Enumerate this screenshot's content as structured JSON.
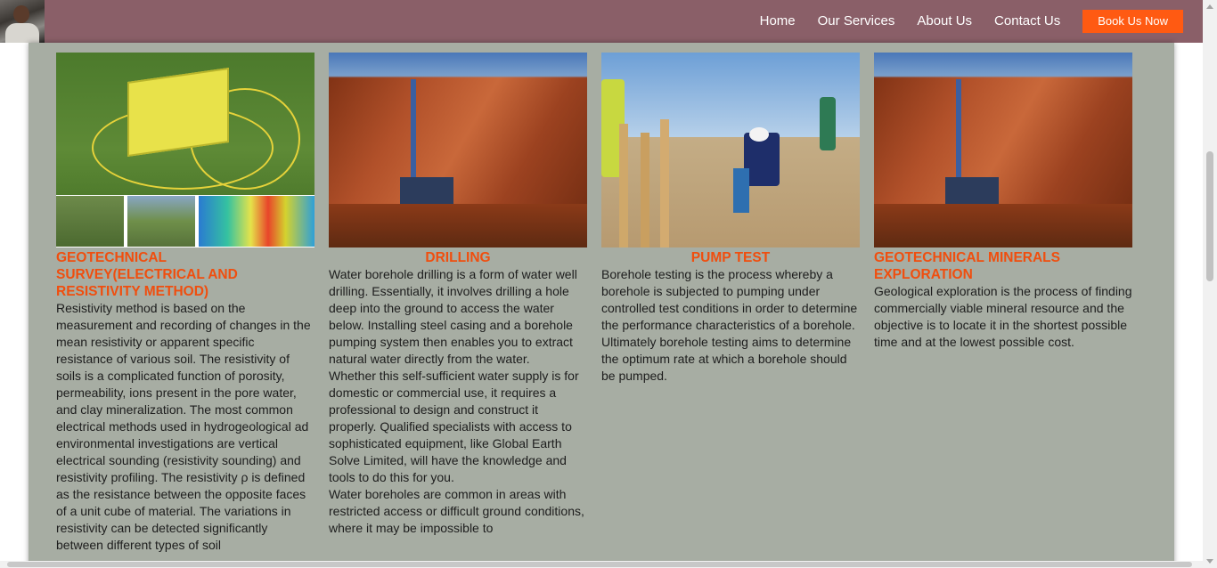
{
  "nav": {
    "items": [
      "Home",
      "Our Services",
      "About Us",
      "Contact Us"
    ],
    "cta": "Book Us Now"
  },
  "colors": {
    "header": "#8a5f68",
    "panel": "#a7ada3",
    "accent": "#f04e0e",
    "cta": "#ff5a12"
  },
  "services": [
    {
      "title": "GEOTECHNICAL SURVEY(ELECTRICAL AND RESISTIVITY METHOD)",
      "body": "Resistivity method is based on the measurement and recording of changes in the mean resistivity or apparent specific resistance of various soil. The resistivity of soils is a complicated function of porosity, permeability, ions present in the pore water, and clay mineralization. The most common electrical methods used in hydrogeological ad environmental investigations are vertical electrical sounding (resistivity sounding) and resistivity profiling. The resistivity ρ is defined as the resistance between the opposite faces of a unit cube of material. The variations in resistivity can be detected significantly between different types of soil"
    },
    {
      "title": "DRILLING",
      "body": "Water borehole drilling is a form of water well drilling. Essentially, it involves drilling a hole deep into the ground to access the water below. Installing steel casing and a borehole pumping system then enables you to extract natural water directly from the water.",
      "body2": "Whether this self-sufficient water supply is for domestic or commercial use, it requires a professional to design and construct it properly. Qualified specialists with access to sophisticated equipment, like Global Earth Solve Limited, will have the knowledge and tools to do this for you.",
      "body3": "Water boreholes are common in areas with restricted access or difficult ground conditions, where it may be impossible to"
    },
    {
      "title": "PUMP TEST",
      "body": "Borehole testing is the process whereby a borehole is subjected to pumping under controlled test conditions in order to determine the performance characteristics of a borehole. Ultimately borehole testing aims to determine the optimum rate at which a borehole should be pumped."
    },
    {
      "title": "GEOTECHNICAL MINERALS EXPLORATION",
      "body": "Geological exploration is the process of finding commercially viable mineral resource and the objective is to locate it in the shortest possible time and at the lowest possible cost."
    }
  ]
}
